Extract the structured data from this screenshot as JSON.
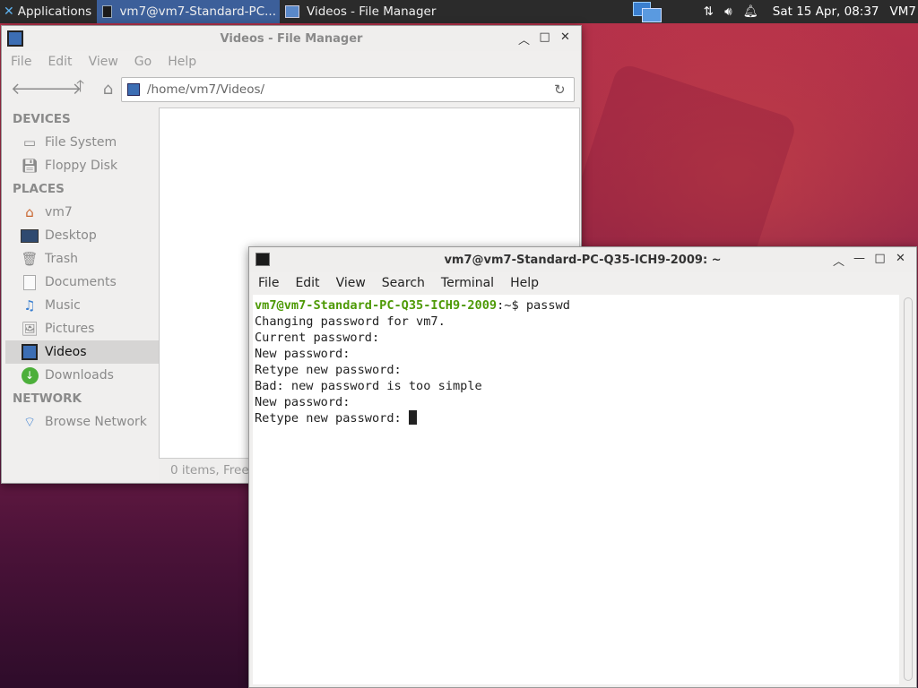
{
  "panel": {
    "applications": "Applications",
    "tasks": [
      {
        "label": "vm7@vm7-Standard-PC...",
        "icon": "terminal-icon"
      },
      {
        "label": "Videos - File Manager",
        "icon": "film-icon"
      }
    ],
    "datetime": "Sat 15 Apr, 08:37",
    "user": "VM7"
  },
  "file_manager": {
    "title": "Videos - File Manager",
    "menu": [
      "File",
      "Edit",
      "View",
      "Go",
      "Help"
    ],
    "path": "/home/vm7/Videos/",
    "sidebar": {
      "devices_header": "DEVICES",
      "devices": [
        {
          "label": "File System",
          "icon": "drive-icon"
        },
        {
          "label": "Floppy Disk",
          "icon": "floppy-icon"
        }
      ],
      "places_header": "PLACES",
      "places": [
        {
          "label": "vm7",
          "icon": "home-icon"
        },
        {
          "label": "Desktop",
          "icon": "desktop-icon"
        },
        {
          "label": "Trash",
          "icon": "trash-icon"
        },
        {
          "label": "Documents",
          "icon": "documents-icon"
        },
        {
          "label": "Music",
          "icon": "music-icon"
        },
        {
          "label": "Pictures",
          "icon": "pictures-icon"
        },
        {
          "label": "Videos",
          "icon": "videos-icon",
          "selected": true
        },
        {
          "label": "Downloads",
          "icon": "downloads-icon"
        }
      ],
      "network_header": "NETWORK",
      "network": [
        {
          "label": "Browse Network",
          "icon": "wifi-icon"
        }
      ]
    },
    "status": "0 items, Free"
  },
  "terminal": {
    "title": "vm7@vm7-Standard-PC-Q35-ICH9-2009: ~",
    "menu": [
      "File",
      "Edit",
      "View",
      "Search",
      "Terminal",
      "Help"
    ],
    "prompt": "vm7@vm7-Standard-PC-Q35-ICH9-2009",
    "prompt_suffix": ":~$ passwd",
    "lines": [
      "Changing password for vm7.",
      "Current password:",
      "New password:",
      "Retype new password:",
      "Bad: new password is too simple",
      "New password:",
      "Retype new password: "
    ]
  },
  "colors": {
    "panel_bg": "#2b2b2b",
    "active_task": "#3c5f9a",
    "prompt_green": "#4e9a06"
  }
}
